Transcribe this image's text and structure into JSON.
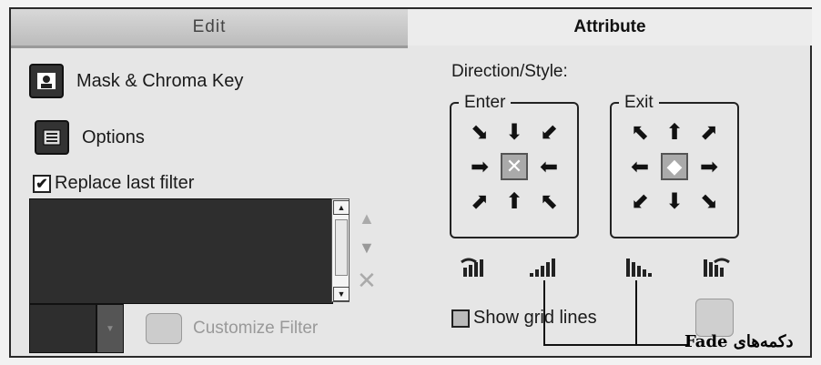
{
  "tabs": {
    "edit": "Edit",
    "attribute": "Attribute"
  },
  "left": {
    "mask_label": "Mask & Chroma Key",
    "options_label": "Options",
    "replace_label": "Replace last filter",
    "replace_checked": true,
    "customize_label": "Customize Filter"
  },
  "right": {
    "direction_label": "Direction/Style:",
    "enter_label": "Enter",
    "exit_label": "Exit",
    "show_grid_label": "Show grid lines",
    "show_grid_checked": false
  },
  "annotation": {
    "label": "دکمه‌های Fade"
  },
  "icons": {
    "enter_arrows": [
      "⬊",
      "⬇",
      "⬋",
      "➡",
      "",
      "⬅",
      "⬈",
      "⬆",
      "⬉"
    ],
    "exit_arrows": [
      "⬉",
      "⬆",
      "⬈",
      "⬅",
      "",
      "➡",
      "⬋",
      "⬇",
      "⬊"
    ]
  }
}
